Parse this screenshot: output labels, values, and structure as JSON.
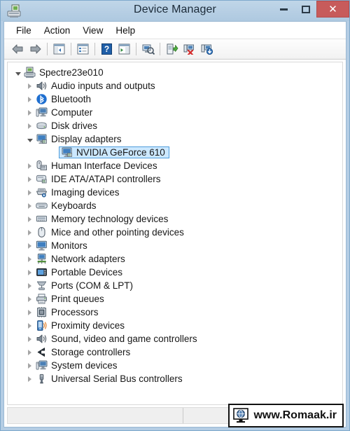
{
  "window": {
    "title": "Device Manager",
    "app_icon": "device-manager-icon",
    "controls": {
      "minimize": "minimize-icon",
      "maximize": "maximize-icon",
      "close": "✕"
    }
  },
  "menubar": {
    "items": [
      {
        "label": "File",
        "name": "menu-file"
      },
      {
        "label": "Action",
        "name": "menu-action"
      },
      {
        "label": "View",
        "name": "menu-view"
      },
      {
        "label": "Help",
        "name": "menu-help"
      }
    ]
  },
  "toolbar": {
    "buttons": [
      {
        "name": "back-button",
        "icon": "back-arrow-icon"
      },
      {
        "name": "forward-button",
        "icon": "forward-arrow-icon"
      },
      {
        "name": "separator-1",
        "icon": "separator"
      },
      {
        "name": "show-hide-console-tree-button",
        "icon": "console-tree-icon"
      },
      {
        "name": "separator-2",
        "icon": "separator"
      },
      {
        "name": "properties-button",
        "icon": "properties-icon"
      },
      {
        "name": "separator-3",
        "icon": "separator"
      },
      {
        "name": "help-button",
        "icon": "help-question-icon"
      },
      {
        "name": "show-hide-action-pane-button",
        "icon": "action-pane-icon"
      },
      {
        "name": "separator-4",
        "icon": "separator"
      },
      {
        "name": "scan-for-hardware-changes-button",
        "icon": "scan-hardware-icon"
      },
      {
        "name": "separator-5",
        "icon": "separator"
      },
      {
        "name": "update-driver-button",
        "icon": "update-driver-icon"
      },
      {
        "name": "uninstall-device-button",
        "icon": "uninstall-device-icon"
      },
      {
        "name": "add-legacy-hardware-button",
        "icon": "add-hardware-icon"
      }
    ]
  },
  "tree": {
    "nodes": [
      {
        "label": "Spectre23e010",
        "level": 0,
        "state": "expanded",
        "icon": "computer-root-icon",
        "selected": false
      },
      {
        "label": "Audio inputs and outputs",
        "level": 1,
        "state": "collapsed",
        "icon": "speaker-icon",
        "selected": false
      },
      {
        "label": "Bluetooth",
        "level": 1,
        "state": "collapsed",
        "icon": "bluetooth-icon",
        "selected": false
      },
      {
        "label": "Computer",
        "level": 1,
        "state": "collapsed",
        "icon": "computer-icon",
        "selected": false
      },
      {
        "label": "Disk drives",
        "level": 1,
        "state": "collapsed",
        "icon": "disk-drive-icon",
        "selected": false
      },
      {
        "label": "Display adapters",
        "level": 1,
        "state": "expanded",
        "icon": "display-adapter-icon",
        "selected": false
      },
      {
        "label": "NVIDIA GeForce 610",
        "level": 2,
        "state": "leaf",
        "icon": "display-adapter-icon",
        "selected": true
      },
      {
        "label": "Human Interface Devices",
        "level": 1,
        "state": "collapsed",
        "icon": "hid-icon",
        "selected": false
      },
      {
        "label": "IDE ATA/ATAPI controllers",
        "level": 1,
        "state": "collapsed",
        "icon": "ide-controller-icon",
        "selected": false
      },
      {
        "label": "Imaging devices",
        "level": 1,
        "state": "collapsed",
        "icon": "imaging-device-icon",
        "selected": false
      },
      {
        "label": "Keyboards",
        "level": 1,
        "state": "collapsed",
        "icon": "keyboard-icon",
        "selected": false
      },
      {
        "label": "Memory technology devices",
        "level": 1,
        "state": "collapsed",
        "icon": "memory-device-icon",
        "selected": false
      },
      {
        "label": "Mice and other pointing devices",
        "level": 1,
        "state": "collapsed",
        "icon": "mouse-icon",
        "selected": false
      },
      {
        "label": "Monitors",
        "level": 1,
        "state": "collapsed",
        "icon": "monitor-icon",
        "selected": false
      },
      {
        "label": "Network adapters",
        "level": 1,
        "state": "collapsed",
        "icon": "network-adapter-icon",
        "selected": false
      },
      {
        "label": "Portable Devices",
        "level": 1,
        "state": "collapsed",
        "icon": "portable-device-icon",
        "selected": false
      },
      {
        "label": "Ports (COM & LPT)",
        "level": 1,
        "state": "collapsed",
        "icon": "port-icon",
        "selected": false
      },
      {
        "label": "Print queues",
        "level": 1,
        "state": "collapsed",
        "icon": "printer-icon",
        "selected": false
      },
      {
        "label": "Processors",
        "level": 1,
        "state": "collapsed",
        "icon": "processor-icon",
        "selected": false
      },
      {
        "label": "Proximity devices",
        "level": 1,
        "state": "collapsed",
        "icon": "proximity-device-icon",
        "selected": false
      },
      {
        "label": "Sound, video and game controllers",
        "level": 1,
        "state": "collapsed",
        "icon": "speaker-icon",
        "selected": false
      },
      {
        "label": "Storage controllers",
        "level": 1,
        "state": "collapsed",
        "icon": "storage-controller-icon",
        "selected": false
      },
      {
        "label": "System devices",
        "level": 1,
        "state": "collapsed",
        "icon": "computer-icon",
        "selected": false
      },
      {
        "label": "Universal Serial Bus controllers",
        "level": 1,
        "state": "collapsed",
        "icon": "usb-icon",
        "selected": false
      }
    ]
  },
  "statusbar": {
    "left_text": "",
    "right_text": ""
  },
  "watermark": {
    "text": "www.Romaak.ir",
    "icon": "globe-monitor-icon"
  },
  "colors": {
    "frame": "#b4cde4",
    "title_text": "#1b2a38",
    "close_button": "#c75b5b",
    "selection_fill": "#cce8ff",
    "selection_border": "#4f9ddb",
    "tree_text": "#171717"
  }
}
